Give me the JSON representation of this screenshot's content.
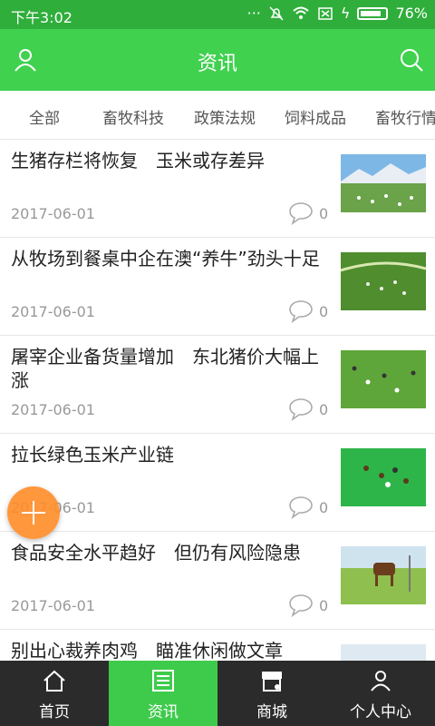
{
  "status_bar": {
    "time": "下午3:02",
    "icons": [
      "dots-icon",
      "mute-icon",
      "wifi-icon",
      "sim-icon",
      "charging-icon",
      "battery-icon"
    ],
    "battery": "76%"
  },
  "header": {
    "title": "资讯",
    "left_icon": "user-icon",
    "right_icon": "search-icon",
    "background": "#40d14f"
  },
  "categories": [
    "全部",
    "畜牧科技",
    "政策法规",
    "饲料成品",
    "畜牧行情"
  ],
  "articles": [
    {
      "title": "生猪存栏将恢复　玉米或存差异",
      "date": "2017-06-01",
      "comments": "0",
      "thumbnail": "mountain-pasture-sheep"
    },
    {
      "title": "从牧场到餐桌中企在澳“养牛”劲头十足",
      "date": "2017-06-01",
      "comments": "0",
      "thumbnail": "green-field-herd"
    },
    {
      "title": "屠宰企业备货量增加　东北猪价大幅上涨",
      "date": "2017-06-01",
      "comments": "0",
      "thumbnail": "grassland-cattle"
    },
    {
      "title": "拉长绿色玉米产业链",
      "date": "2017-06-01",
      "comments": "0",
      "thumbnail": "green-meadow-cattle"
    },
    {
      "title": "食品安全水平趋好　但仍有风险隐患",
      "date": "2017-06-01",
      "comments": "0",
      "thumbnail": "horses-field"
    },
    {
      "title": "别出心裁养肉鸡　瞄准休闲做文章",
      "date": "",
      "comments": "",
      "thumbnail": "pasture"
    }
  ],
  "fab": {
    "icon": "plus-icon",
    "color": "#ff8c28"
  },
  "bottom_nav": [
    {
      "label": "首页",
      "icon": "home-icon"
    },
    {
      "label": "资讯",
      "icon": "news-icon",
      "active": true
    },
    {
      "label": "商城",
      "icon": "store-icon"
    },
    {
      "label": "个人中心",
      "icon": "profile-icon"
    }
  ]
}
